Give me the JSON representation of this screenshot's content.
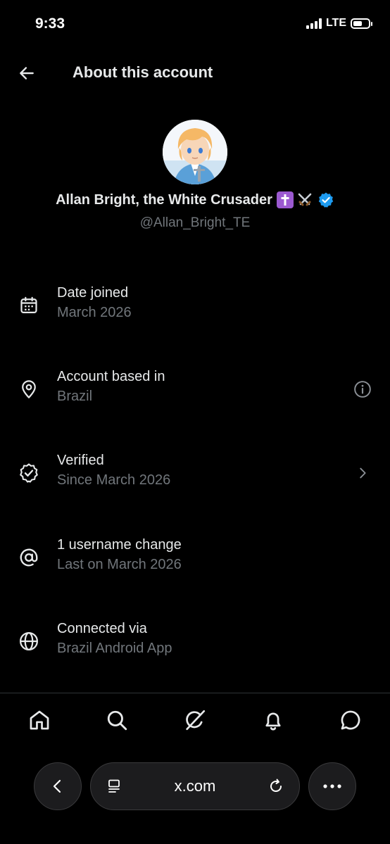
{
  "status_bar": {
    "time": "9:33",
    "network": "LTE",
    "battery_level": 0.6
  },
  "header": {
    "title": "About this account",
    "back_icon": "arrow-left-icon"
  },
  "profile": {
    "display_name": "Allan Bright, the White Crusader",
    "name_emojis": [
      "latin-cross-emoji",
      "crossed-swords-emoji"
    ],
    "verified_badge": "verified-badge-icon",
    "handle": "@Allan_Bright_TE"
  },
  "info_items": [
    {
      "icon": "calendar-icon",
      "title": "Date joined",
      "subtitle": "March 2026",
      "trailing": ""
    },
    {
      "icon": "location-pin-icon",
      "title": "Account based in",
      "subtitle": "Brazil",
      "trailing": "info-icon"
    },
    {
      "icon": "verified-outline-icon",
      "title": "Verified",
      "subtitle": "Since March 2026",
      "trailing": "chevron-right-icon"
    },
    {
      "icon": "at-sign-icon",
      "title": "1 username change",
      "subtitle": "Last on March 2026",
      "trailing": ""
    },
    {
      "icon": "globe-icon",
      "title": "Connected via",
      "subtitle": "Brazil Android App",
      "trailing": ""
    }
  ],
  "bottom_nav": [
    "home-icon",
    "search-icon",
    "grok-icon",
    "notifications-bell-icon",
    "messages-icon"
  ],
  "browser": {
    "url": "x.com",
    "back_icon": "chevron-left-icon",
    "tabs_icon": "tab-layout-icon",
    "reload_icon": "reload-icon",
    "menu_icon": "more-dots-icon"
  },
  "colors": {
    "background": "#000000",
    "primary_text": "#e7e9ea",
    "secondary_text": "#71767b",
    "verified_blue": "#1d9bf0",
    "emoji_purple": "#9b59d0"
  }
}
